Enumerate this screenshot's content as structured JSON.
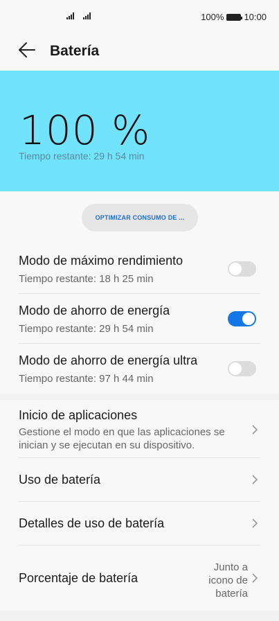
{
  "status_bar": {
    "battery": "100%",
    "time": "10:00"
  },
  "header": {
    "title": "Batería"
  },
  "hero": {
    "percentage": "100 %",
    "remaining": "Tiempo restante: 29 h 54 min"
  },
  "optimize_button": "OPTIMIZAR CONSUMO DE ...",
  "modes": [
    {
      "title": "Modo de máximo rendimiento",
      "subtitle": "Tiempo restante: 18 h 25 min",
      "enabled": false
    },
    {
      "title": "Modo de ahorro de energía",
      "subtitle": "Tiempo restante: 29 h 54 min",
      "enabled": true
    },
    {
      "title": "Modo de ahorro de energía ultra",
      "subtitle": "Tiempo restante: 97 h 44 min",
      "enabled": false
    }
  ],
  "settings": [
    {
      "title": "Inicio de aplicaciones",
      "subtitle": "Gestione el modo en que las aplicaciones se inician y se ejecutan en su dispositivo."
    },
    {
      "title": "Uso de batería"
    },
    {
      "title": "Detalles de uso de batería"
    },
    {
      "title": "Porcentaje de batería",
      "value": "Junto a icono de batería"
    }
  ],
  "colors": {
    "hero": "#72e3fd",
    "accent": "#1477e8"
  },
  "icons": [
    "signal-icon",
    "battery-icon",
    "back-arrow-icon",
    "chevron-right-icon"
  ]
}
